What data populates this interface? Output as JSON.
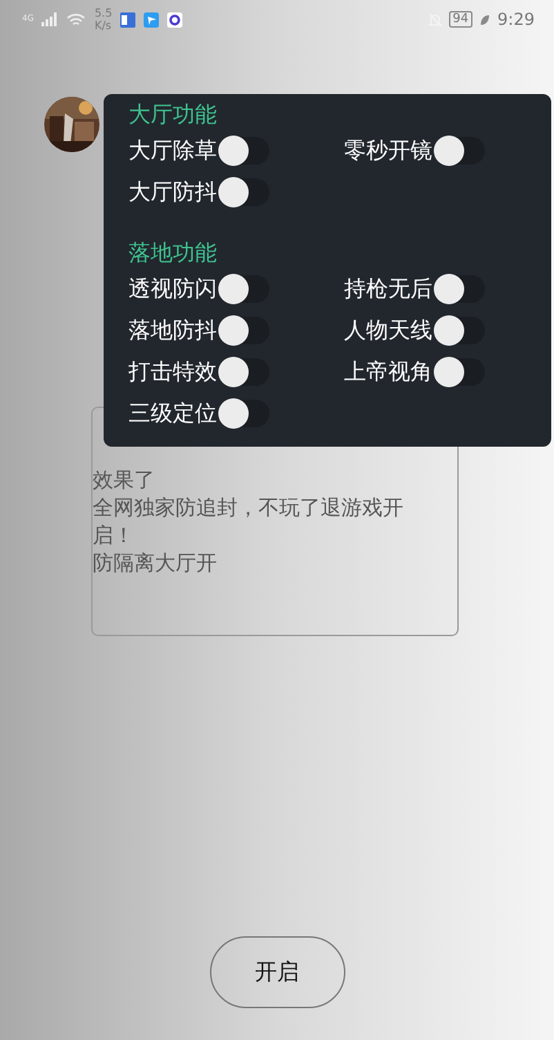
{
  "status_bar": {
    "network": "4G",
    "speed": "5.5",
    "speed_unit": "K/s",
    "battery": "94",
    "time": "9:29"
  },
  "menu": {
    "sections": [
      {
        "title": "大厅功能",
        "items": [
          {
            "label": "大厅除草",
            "on": false
          },
          {
            "label": "零秒开镜",
            "on": false
          },
          {
            "label": "大厅防抖",
            "on": false
          }
        ]
      },
      {
        "title": "落地功能",
        "items": [
          {
            "label": "透视防闪",
            "on": false
          },
          {
            "label": "持枪无后",
            "on": false
          },
          {
            "label": "落地防抖",
            "on": false
          },
          {
            "label": "人物天线",
            "on": false
          },
          {
            "label": "打击特效",
            "on": false
          },
          {
            "label": "上帝视角",
            "on": false
          },
          {
            "label": "三级定位",
            "on": false
          }
        ]
      }
    ]
  },
  "notice": {
    "lines": [
      "效果了",
      "全网独家防追封，不玩了退游戏开启！",
      "防隔离大厅开"
    ]
  },
  "button": {
    "label": "开启"
  }
}
